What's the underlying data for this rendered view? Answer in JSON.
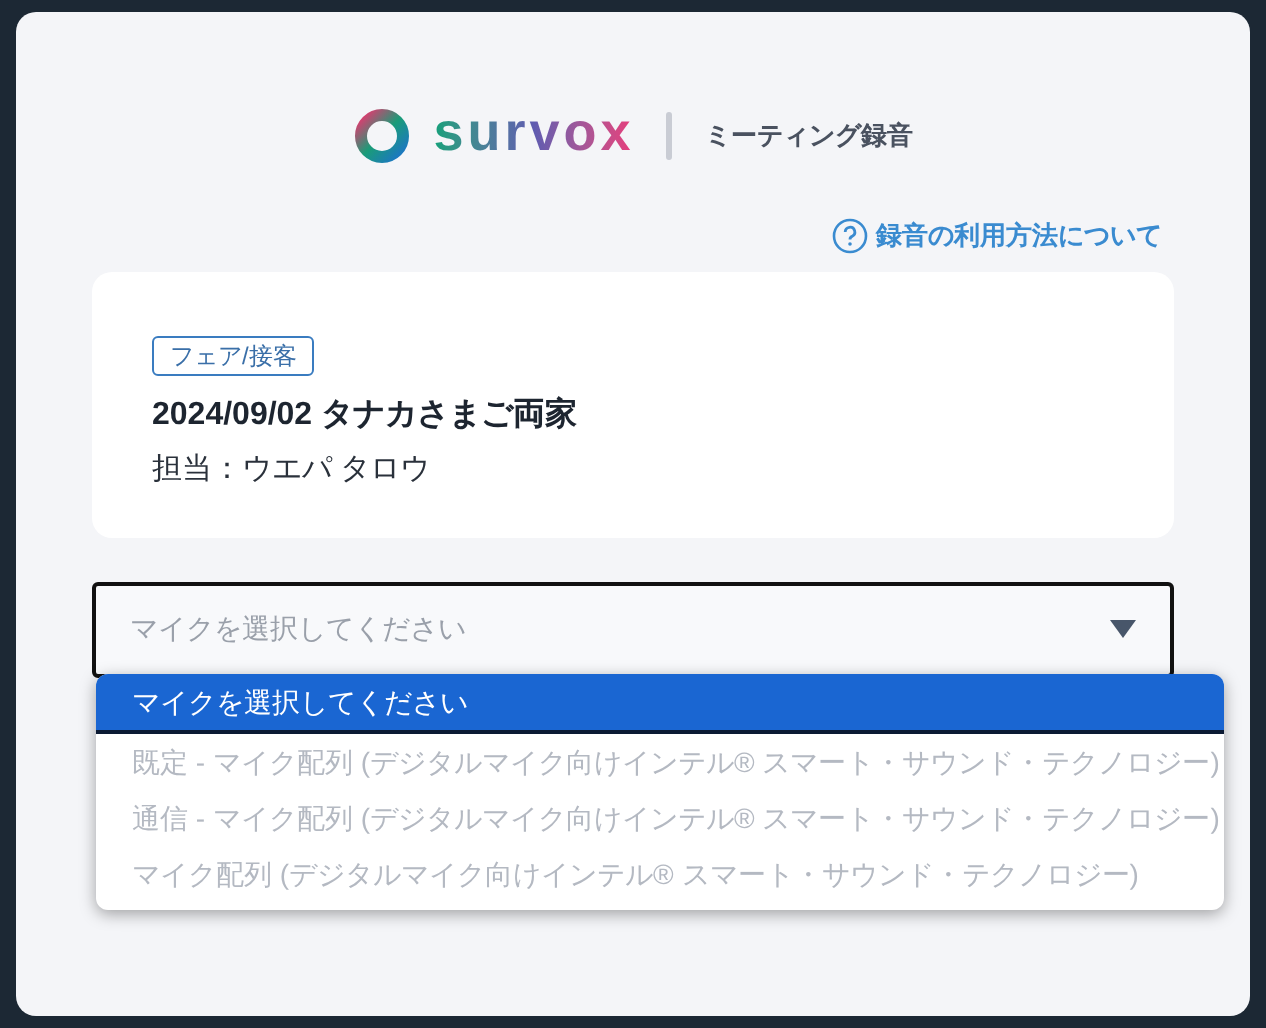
{
  "header": {
    "logo": "survox",
    "subtitle": "ミーティング録音"
  },
  "help_link": {
    "label": "録音の利用方法について"
  },
  "meeting": {
    "tag": "フェア/接客",
    "title": "2024/09/02 タナカさまご両家",
    "assignee": "担当：ウエパ タロウ"
  },
  "mic_select": {
    "placeholder": "マイクを選択してください",
    "expanded": true,
    "options": [
      {
        "label": "マイクを選択してください",
        "selected": true,
        "disabled": false
      },
      {
        "label": "既定 - マイク配列 (デジタルマイク向けインテル® スマート・サウンド・テクノロジー)",
        "selected": false,
        "disabled": true
      },
      {
        "label": "通信 - マイク配列 (デジタルマイク向けインテル® スマート・サウンド・テクノロジー)",
        "selected": false,
        "disabled": true
      },
      {
        "label": "マイク配列 (デジタルマイク向けインテル® スマート・サウンド・テクノロジー)",
        "selected": false,
        "disabled": true
      }
    ]
  }
}
